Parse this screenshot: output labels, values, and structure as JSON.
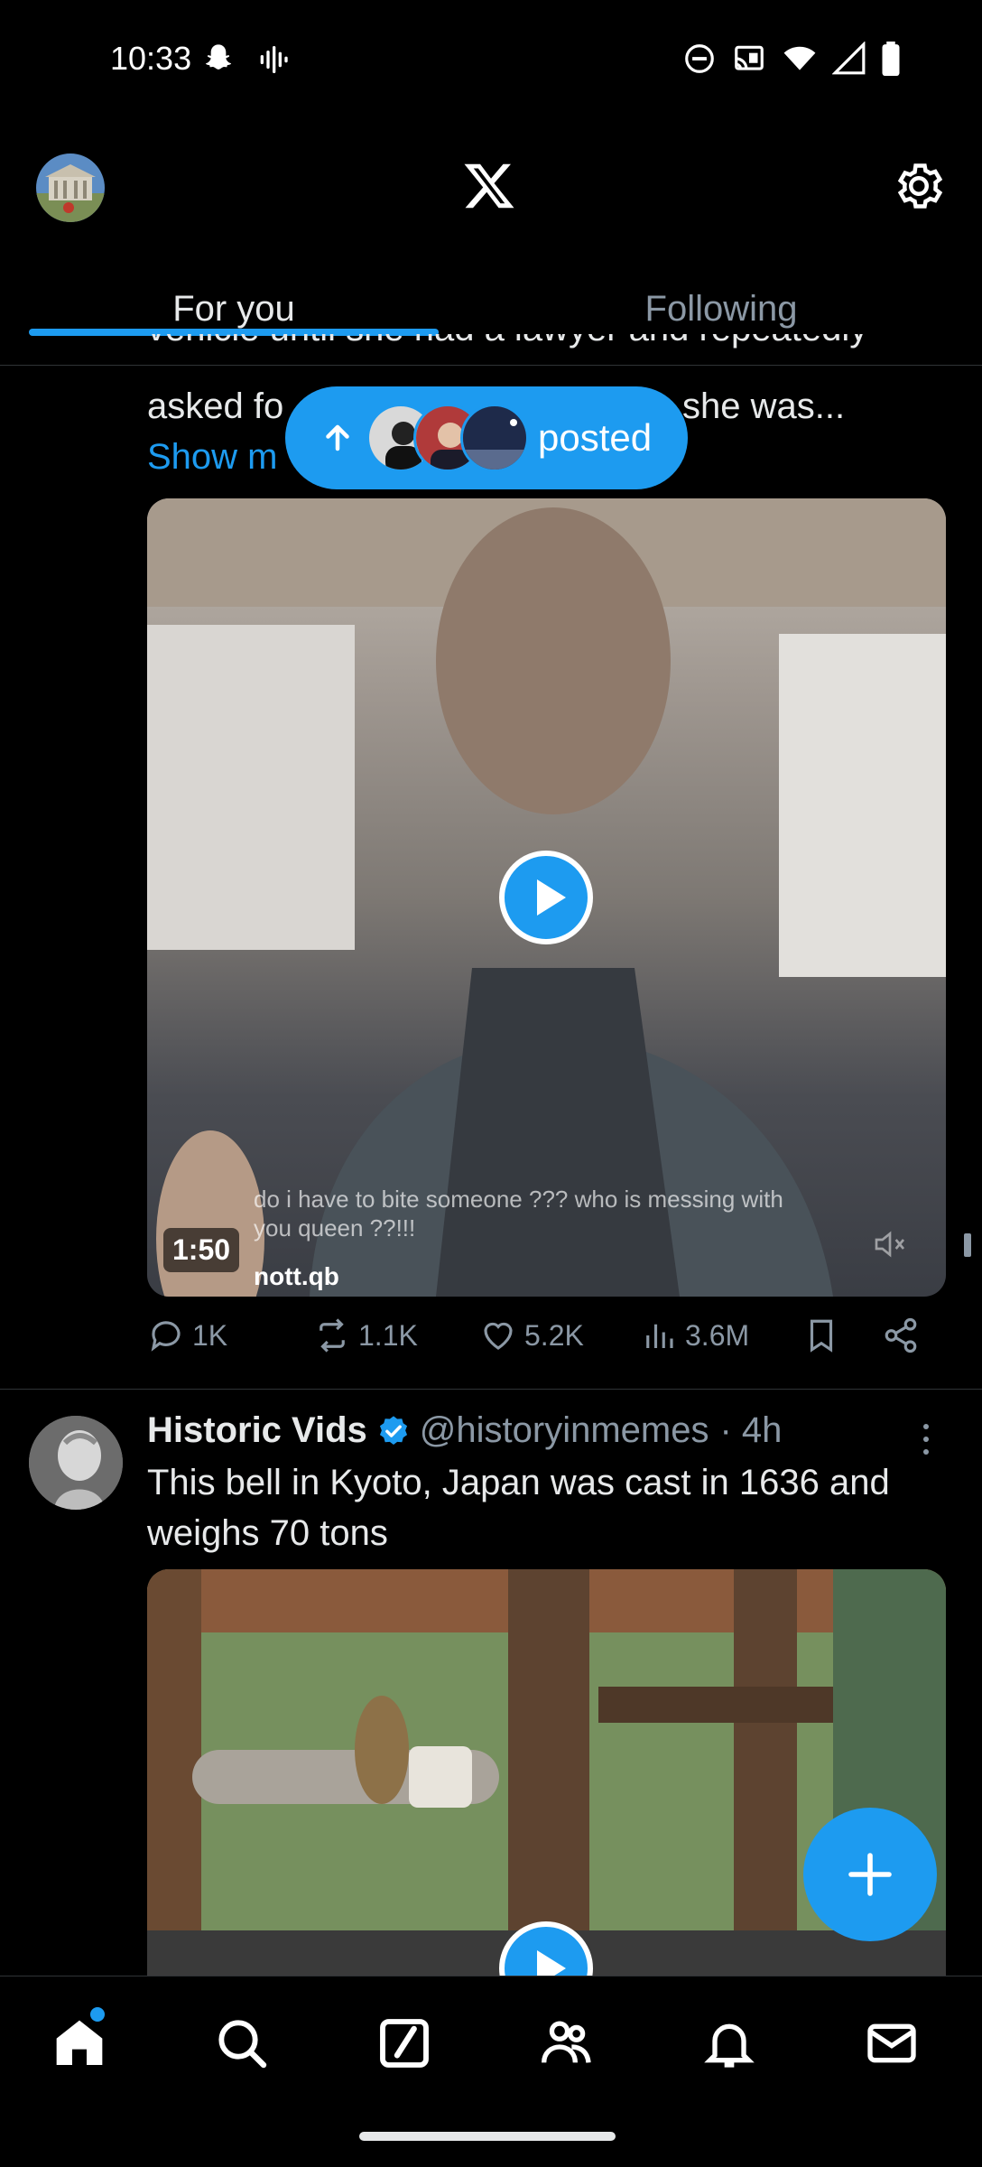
{
  "status_bar": {
    "time": "10:33",
    "icons_left": [
      "snapchat-icon",
      "voice-icon"
    ],
    "icons_right": [
      "dnd-icon",
      "cast-icon",
      "wifi-icon",
      "signal-icon",
      "battery-icon"
    ]
  },
  "header": {
    "logo": "X",
    "tabs": [
      {
        "label": "For you",
        "active": true
      },
      {
        "label": "Following",
        "active": false
      }
    ]
  },
  "new_posts_pill": {
    "label": "posted"
  },
  "tweet1": {
    "text_partial_line1": "vehicle until she had a lawyer and repeatedly",
    "text_line2_left": "asked fo",
    "text_line2_right": "she was...",
    "show_more": "Show m",
    "video": {
      "duration": "1:50",
      "caption": "do i have to bite someone ??? who is messing with",
      "caption2": "you queen ??!!!",
      "username": "nott.qb"
    },
    "actions": {
      "replies": "1K",
      "reposts": "1.1K",
      "likes": "5.2K",
      "views": "3.6M"
    }
  },
  "tweet2": {
    "name": "Historic Vids",
    "handle": "@historyinmemes",
    "time": "· 4h",
    "text": "This bell in Kyoto, Japan was cast in 1636 and weighs 70 tons"
  },
  "colors": {
    "accent": "#1d9bf0",
    "background": "#000000",
    "text_primary": "#e7e9ea",
    "text_secondary": "#8b98a5"
  }
}
